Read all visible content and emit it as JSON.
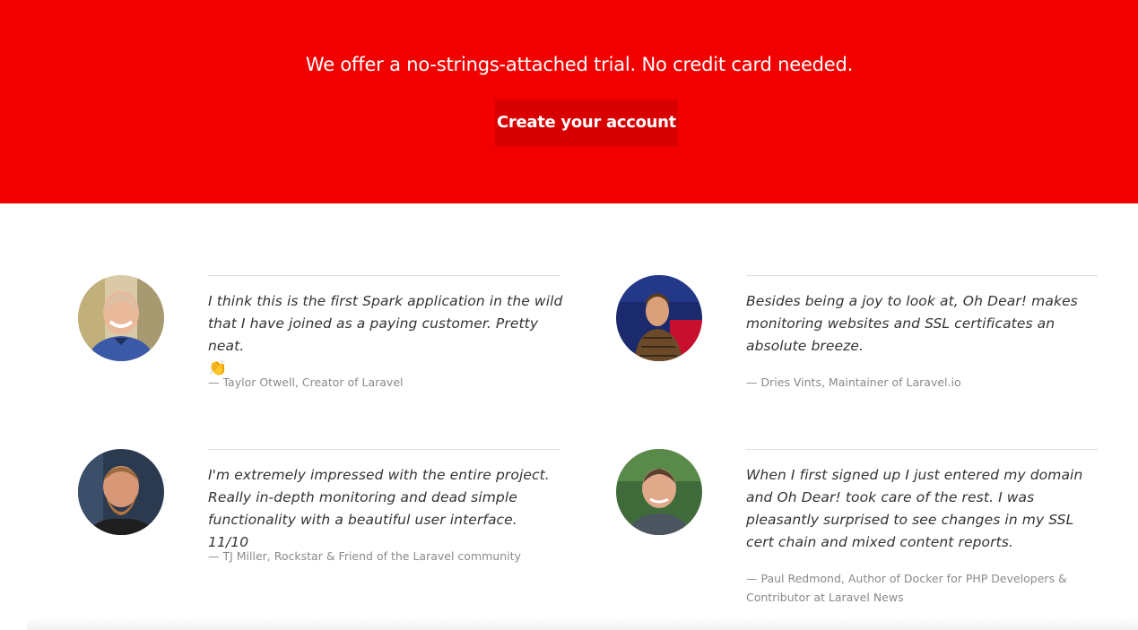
{
  "hero": {
    "headline": "We offer a no-strings-attached trial. No credit card needed.",
    "cta_label": "Create your account",
    "background_color": "#f20000",
    "cta_color": "#d80000"
  },
  "testimonials": [
    {
      "quote": "I think this is the first Spark application in the wild that I have joined as a paying customer. Pretty neat.",
      "emoji": "👏",
      "author": "— Taylor Otwell, Creator of Laravel"
    },
    {
      "quote": "Besides being a joy to look at, Oh Dear! makes monitoring websites and SSL certificates an absolute breeze.",
      "author": "— Dries Vints, Maintainer of Laravel.io"
    },
    {
      "quote": "I'm extremely impressed with the entire project. Really in-depth monitoring and dead simple functionality with a beautiful user interface. 11/10",
      "author": "— TJ Miller, Rockstar & Friend of the Laravel community"
    },
    {
      "quote": "When I first signed up I just entered my domain and Oh Dear! took care of the rest. I was pleasantly surprised to see changes in my SSL cert chain and mixed content reports.",
      "author": "— Paul Redmond, Author of Docker for PHP Developers & Contributor at Laravel News"
    }
  ]
}
